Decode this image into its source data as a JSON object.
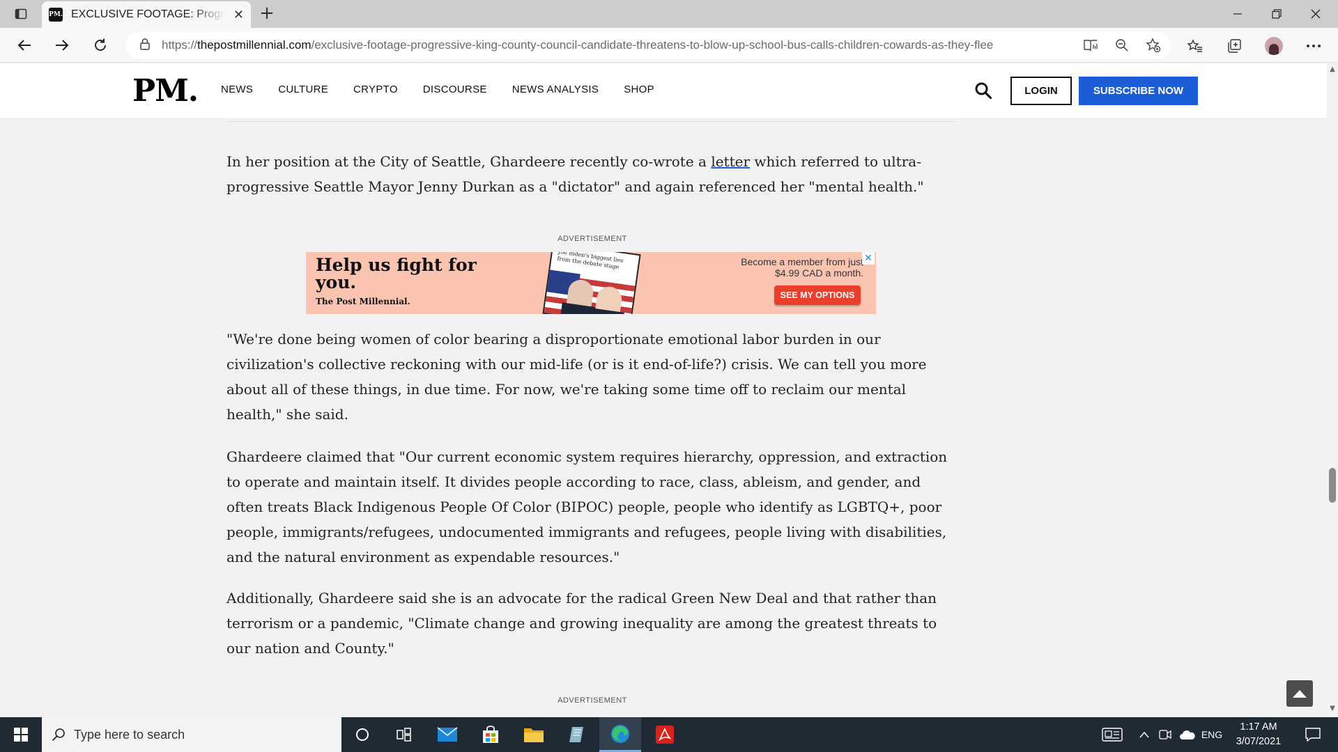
{
  "browser": {
    "tab_title": "EXCLUSIVE FOOTAGE: Progressive King County Council candidate threatens to blow up school bus",
    "favicon_text": "PM.",
    "url_prefix": "https://",
    "url_host": "thepostmillennial.com",
    "url_path": "/exclusive-footage-progressive-king-county-council-candidate-threatens-to-blow-up-school-bus-calls-children-cowards-as-they-flee"
  },
  "site": {
    "logo": "PM.",
    "nav": [
      "NEWS",
      "CULTURE",
      "CRYPTO",
      "DISCOURSE",
      "NEWS ANALYSIS",
      "SHOP"
    ],
    "login_label": "LOGIN",
    "subscribe_label": "SUBSCRIBE NOW"
  },
  "article": {
    "p1_before": "In her position at the City of Seattle, Ghardeere recently co-wrote a ",
    "p1_link": "letter",
    "p1_after": " which referred to ultra-progressive Seattle Mayor Jenny Durkan as a \"dictator\" and again referenced her \"mental health.\"",
    "ad_label": "ADVERTISEMENT",
    "p2": "\"We're done being women of color bearing a disproportionate emotional labor burden in our civilization's collective reckoning with our mid-life (or is it end-of-life?) crisis. We can tell you more about all of these things, in due time. For now, we're taking some time off to reclaim our mental health,\" she said.",
    "p3": "Ghardeere claimed that \"Our current economic system requires hierarchy, oppression, and extraction to operate and maintain itself. It divides people according to race, class, ableism, and gender, and often treats Black Indigenous People Of Color (BIPOC) people, people who identify as LGBTQ+, poor people, immigrants/refugees, undocumented immigrants and refugees, people living with disabilities, and the natural environment as expendable resources.\"",
    "p4": "Additionally, Ghardeere said she is an advocate for the radical Green New Deal and that rather than terrorism or a pandemic, \"Climate change and growing inequality are among the greatest threats to our nation and County.\"",
    "ad_label_2": "ADVERTISEMENT"
  },
  "ad": {
    "headline": "Help us fight for you.",
    "brand": "The Post Millennial.",
    "image_caption": "Joe Biden's biggest lies from the debate stage",
    "offer_line1": "Become a member from just",
    "offer_line2": "$4.99 CAD a month.",
    "cta": "SEE MY OPTIONS",
    "close": "✕"
  },
  "taskbar": {
    "search_placeholder": "Type here to search",
    "language": "ENG",
    "time": "1:17 AM",
    "date": "3/07/2021"
  },
  "colors": {
    "subscribe_blue": "#1a5dd6",
    "ad_background": "#fbc4b0",
    "ad_cta": "#e8402d",
    "taskbar": "#202a35"
  }
}
